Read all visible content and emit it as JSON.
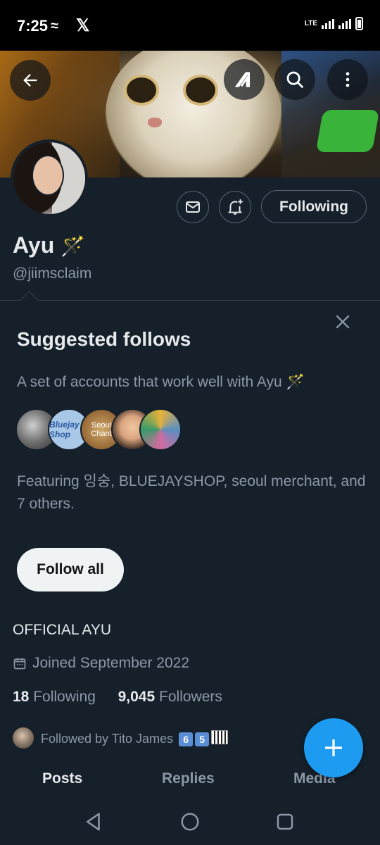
{
  "status_bar": {
    "time": "7:25",
    "network": "LTE"
  },
  "profile": {
    "name": "Ayu",
    "name_emoji": "🪄",
    "handle": "@jiimsclaim",
    "bio": "OFFICIAL AYU",
    "joined": "Joined September 2022",
    "following_count": "18",
    "following_label": "Following",
    "followers_count": "9,045",
    "followers_label": "Followers",
    "followed_by_text": "Followed by Tito James",
    "followed_by_emojis": [
      "6",
      "5"
    ]
  },
  "actions": {
    "following_button": "Following"
  },
  "suggested": {
    "title": "Suggested follows",
    "subtitle": "A set of accounts that work well with Ayu 🪄",
    "featuring": "Featuring 잉숭, BLUEJAYSHOP, seoul merchant, and 7 others.",
    "follow_all": "Follow all",
    "face_colors": [
      "#6f6f6f",
      "#a9c8e8",
      "#b07a3c",
      "#d9a47e",
      "#5b8fc2"
    ],
    "face_labels": [
      "",
      "Bluejay Shop",
      "Seoul Chant",
      "",
      ""
    ]
  },
  "tabs": [
    "Posts",
    "Replies",
    "Media"
  ],
  "active_tab": "Posts",
  "colors": {
    "accent": "#1d9bf0",
    "background": "#15202b",
    "muted": "#8b98a5"
  },
  "icons": [
    "back-arrow-icon",
    "grok-icon",
    "search-icon",
    "more-icon",
    "mail-icon",
    "bell-plus-icon",
    "close-icon",
    "calendar-icon",
    "plus-icon",
    "back-triangle-icon",
    "home-circle-icon",
    "recents-square-icon"
  ]
}
